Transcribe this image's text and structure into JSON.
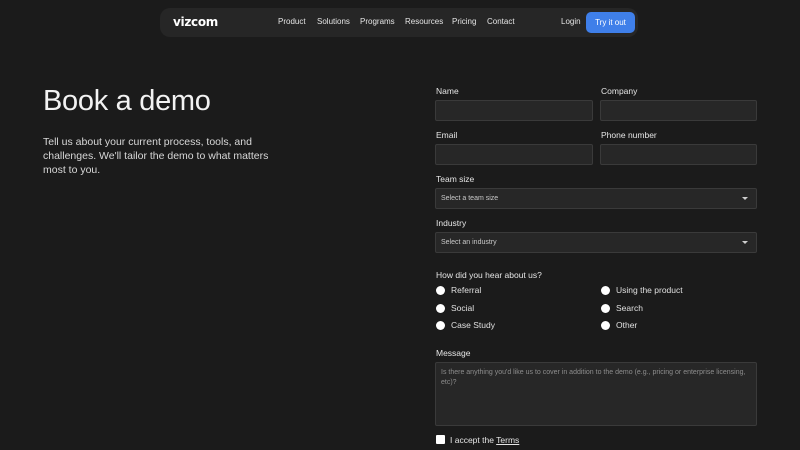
{
  "nav": {
    "logo": "vizcom",
    "links": [
      "Product",
      "Solutions",
      "Programs",
      "Resources",
      "Pricing",
      "Contact"
    ],
    "login": "Login",
    "cta": "Try it out"
  },
  "hero": {
    "title": "Book a demo",
    "description": "Tell us about your current process, tools, and challenges. We'll tailor the demo to what matters most to you."
  },
  "form": {
    "name_label": "Name",
    "company_label": "Company",
    "email_label": "Email",
    "phone_label": "Phone number",
    "team_size_label": "Team size",
    "team_size_value": "Select a team size",
    "industry_label": "Industry",
    "industry_value": "Select an industry",
    "hear_label": "How did you hear about us?",
    "hear_options": [
      "Referral",
      "Social",
      "Case Study",
      "Using the product",
      "Search",
      "Other"
    ],
    "message_label": "Message",
    "message_placeholder": "Is there anything you'd like us to cover in addition to the demo (e.g., pricing or enterprise licensing, etc)?",
    "accept_prefix": "I accept the",
    "terms_link": "Terms"
  },
  "colors": {
    "background": "#1b1b1b",
    "nav_background": "#262626",
    "cta": "#3f7fe9",
    "input_background": "#272727"
  }
}
